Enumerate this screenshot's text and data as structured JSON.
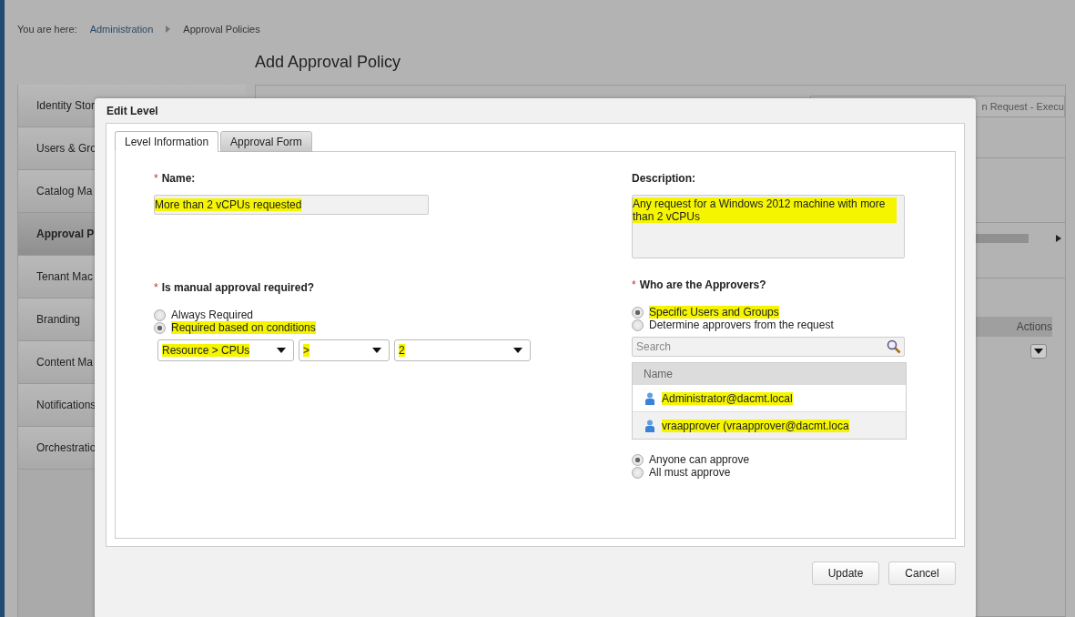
{
  "breadcrumb": {
    "label": "You are here:",
    "items": [
      "Administration",
      "Approval Policies"
    ]
  },
  "page_title": "Add Approval Policy",
  "sidebar": {
    "items": [
      {
        "label": "Identity Stor",
        "selected": false
      },
      {
        "label": "Users & Gro",
        "selected": false
      },
      {
        "label": "Catalog Ma",
        "selected": false
      },
      {
        "label": "Approval P",
        "selected": true
      },
      {
        "label": "Tenant Mac",
        "selected": false
      },
      {
        "label": "Branding",
        "selected": false
      },
      {
        "label": "Content Ma",
        "selected": false
      },
      {
        "label": "Notifications",
        "selected": false
      },
      {
        "label": "Orchestratio",
        "selected": false
      }
    ]
  },
  "background_panel": {
    "field_text": "n Request - Execu",
    "table_columns": [
      "Actions"
    ]
  },
  "dialog": {
    "title": "Edit Level",
    "tabs": [
      {
        "label": "Level Information",
        "selected": true
      },
      {
        "label": "Approval Form",
        "selected": false
      }
    ],
    "name": {
      "required_mark": "*",
      "label": "Name:",
      "value": "More than 2 vCPUs requested",
      "highlighted": true
    },
    "description": {
      "label": "Description:",
      "value": "Any request for a Windows 2012 machine with more than 2 vCPUs",
      "highlighted": true
    },
    "manual_approval": {
      "required_mark": "*",
      "label": "Is manual approval required?",
      "options": [
        {
          "label": "Always Required",
          "selected": false,
          "highlighted": false
        },
        {
          "label": "Required based on conditions",
          "selected": true,
          "highlighted": true
        }
      ],
      "conditions": [
        {
          "value": "Resource > CPUs",
          "highlighted": true
        },
        {
          "value": ">",
          "highlighted": true
        },
        {
          "value": "2",
          "highlighted": true
        }
      ]
    },
    "approvers": {
      "required_mark": "*",
      "label": "Who are the Approvers?",
      "options": [
        {
          "label": "Specific Users and Groups",
          "selected": true,
          "highlighted": true
        },
        {
          "label": "Determine approvers from the request",
          "selected": false,
          "highlighted": false
        }
      ],
      "search": {
        "placeholder": "Search"
      },
      "table": {
        "columns": [
          "Name"
        ],
        "rows": [
          {
            "name": "Administrator@dacmt.local",
            "highlighted": true
          },
          {
            "name": "vraapprover (vraapprover@dacmt.loca",
            "highlighted": true
          }
        ]
      },
      "approval_mode": [
        {
          "label": "Anyone can approve",
          "selected": true
        },
        {
          "label": "All must approve",
          "selected": false
        }
      ]
    },
    "buttons": [
      "Update",
      "Cancel"
    ]
  }
}
